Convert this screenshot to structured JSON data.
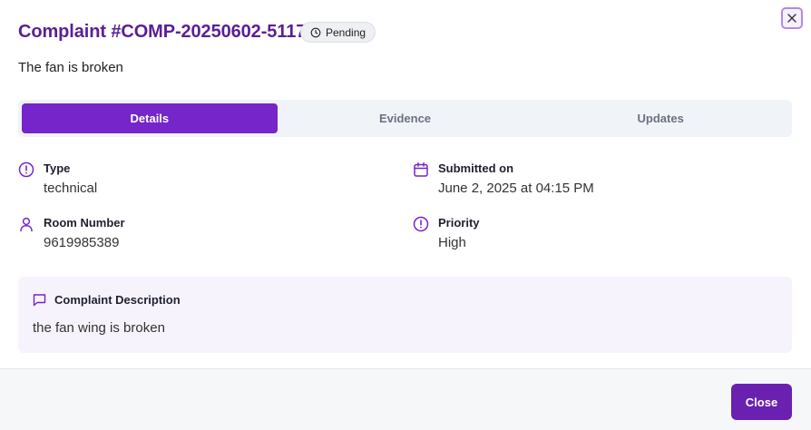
{
  "header": {
    "title": "Complaint #COMP-20250602-5117",
    "status": "Pending",
    "subtitle": "The fan is broken"
  },
  "tabs": [
    {
      "label": "Details",
      "active": true
    },
    {
      "label": "Evidence",
      "active": false
    },
    {
      "label": "Updates",
      "active": false
    }
  ],
  "details": {
    "type": {
      "label": "Type",
      "value": "technical",
      "icon": "alert-circle-icon"
    },
    "submitted": {
      "label": "Submitted on",
      "value": "June 2, 2025 at 04:15 PM",
      "icon": "calendar-icon"
    },
    "room": {
      "label": "Room Number",
      "value": "9619985389",
      "icon": "user-icon"
    },
    "priority": {
      "label": "Priority",
      "value": "High",
      "icon": "alert-circle-icon"
    }
  },
  "description": {
    "heading": "Complaint Description",
    "text": "the fan wing is broken",
    "icon": "message-square-icon"
  },
  "footer": {
    "close_label": "Close"
  },
  "colors": {
    "accent": "#7525c9",
    "title": "#5b1e96",
    "panel": "#f6f3fc"
  }
}
